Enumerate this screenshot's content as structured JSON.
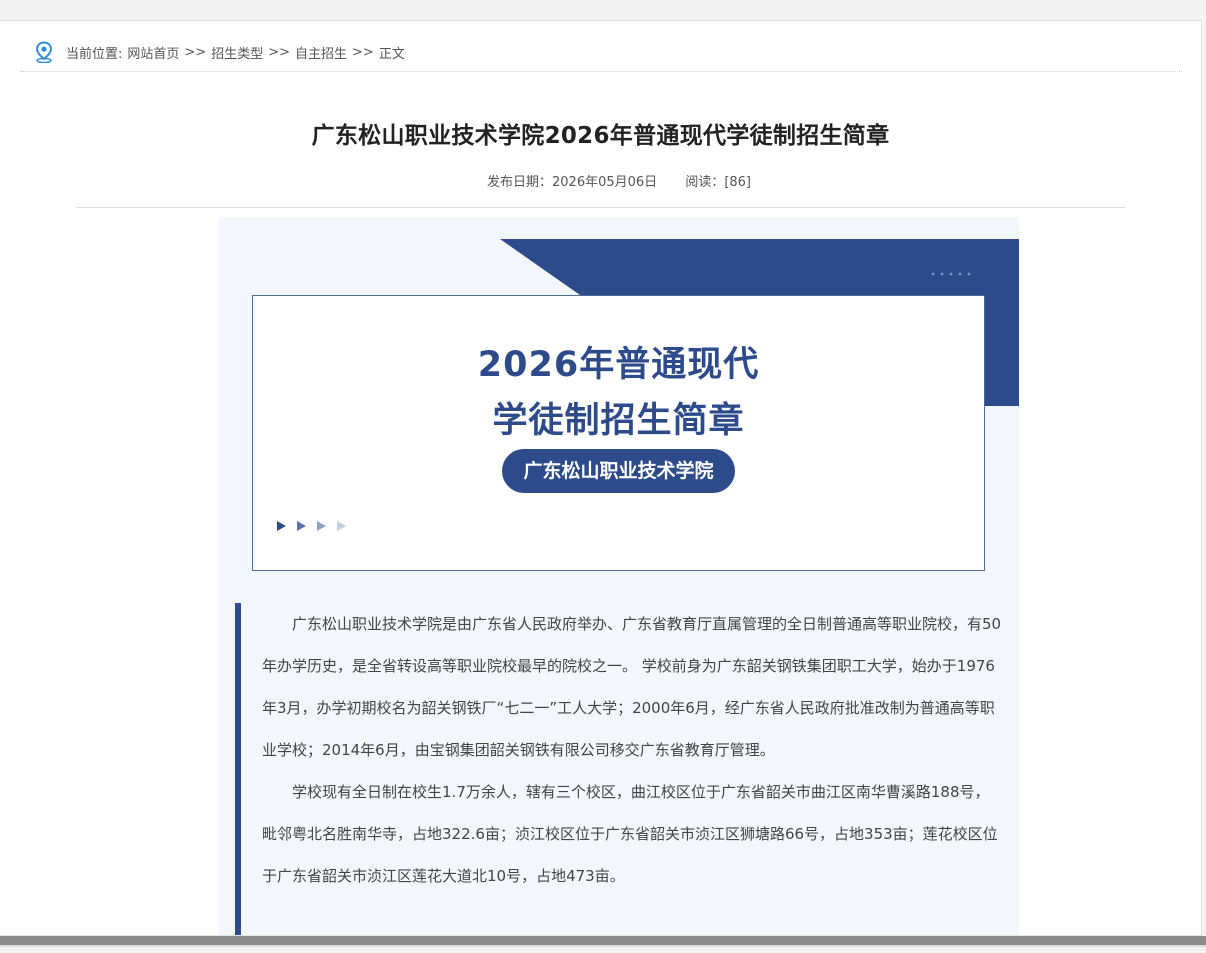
{
  "breadcrumb": {
    "label": "当前位置:",
    "items": [
      "网站首页",
      "招生类型",
      "自主招生",
      "正文"
    ],
    "separator": ">>",
    "icon": "location-pin-icon"
  },
  "article": {
    "title": "广东松山职业技术学院2026年普通现代学徒制招生简章",
    "publish_date": "发布日期：2026年05月06日",
    "reads": "阅读：[86]"
  },
  "poster": {
    "heading_line1": "2026年普通现代",
    "heading_line2": "学徒制招生简章",
    "school_name": "广东松山职业技术学院"
  },
  "body": {
    "paragraphs": [
      "广东松山职业技术学院是由广东省人民政府举办、广东省教育厅直属管理的全日制普通高等职业院校，有50年办学历史，是全省转设高等职业院校最早的院校之一。 学校前身为广东韶关钢铁集团职工大学，始办于1976年3月，办学初期校名为韶关钢铁厂“七二一”工人大学；2000年6月，经广东省人民政府批准改制为普通高等职业学校；2014年6月，由宝钢集团韶关钢铁有限公司移交广东省教育厅管理。",
      "学校现有全日制在校生1.7万余人，辖有三个校区，曲江校区位于广东省韶关市曲江区南华曹溪路188号，毗邻粤北名胜南华寺，占地322.6亩；浈江校区位于广东省韶关市浈江区狮塘路66号，占地353亩；莲花校区位于广东省韶关市浈江区莲花大道北10号，占地473亩。"
    ]
  },
  "colors": {
    "brand_blue": "#2d4b8a",
    "pin_blue": "#2f8ad8"
  }
}
